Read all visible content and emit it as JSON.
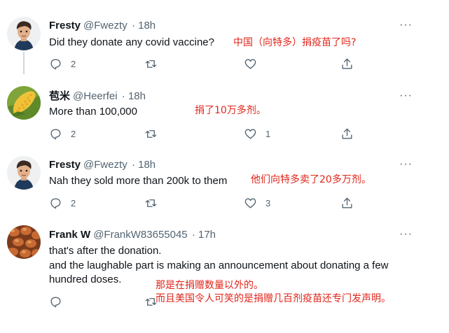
{
  "tweets": [
    {
      "name": "Fresty",
      "handle": "@Fwezty",
      "time": "· 18h",
      "lines": [
        "Did they donate any covid vaccine?"
      ],
      "annotation": "中国（向特多）捐疫苗了吗?",
      "replies": "2",
      "retweets": "",
      "likes": "",
      "more": "···"
    },
    {
      "name": "苞米",
      "handle": "@Heerfei",
      "time": "· 18h",
      "lines": [
        "More than 100,000"
      ],
      "annotation": "捐了10万多剂。",
      "replies": "2",
      "retweets": "",
      "likes": "1",
      "more": "···"
    },
    {
      "name": "Fresty",
      "handle": "@Fwezty",
      "time": "· 18h",
      "lines": [
        "Nah they sold more than 200k to them"
      ],
      "annotation": "他们向特多卖了20多万剂。",
      "replies": "2",
      "retweets": "",
      "likes": "3",
      "more": "···"
    },
    {
      "name": "Frank W",
      "handle": "@FrankW83655045",
      "time": "· 17h",
      "lines": [
        "that's after the donation.",
        "and the laughable part is making an announcement about donating a few",
        "hundred doses."
      ],
      "annotation_lines": [
        "那是在捐赠数量以外的。",
        "而且美国令人可笑的是捐赠几百剂疫苗还专门发声明。"
      ],
      "replies": "",
      "retweets": "",
      "likes": "",
      "more": "···"
    }
  ],
  "colors": {
    "annotation": "#e0261b",
    "muted": "#536471",
    "thread_line": "#cfd9de"
  },
  "icons": [
    "reply-icon",
    "retweet-icon",
    "like-icon",
    "share-icon"
  ]
}
